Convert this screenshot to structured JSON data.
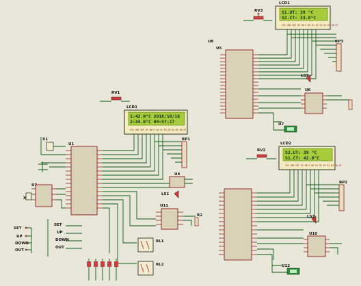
{
  "lcds": [
    {
      "id": "lcd-top",
      "label": "LCD1",
      "line1": "S1.UT: 39 °C",
      "line2": "S2.CT: 34.0°C"
    },
    {
      "id": "lcd-left",
      "label": "LCD1",
      "line1": "1:42.0°C  2018/10/16",
      "line2": "2:34.0°C    09:57:17"
    },
    {
      "id": "lcd-right",
      "label": "LCD2",
      "line1": "S2.UT: 39 °C",
      "line2": "S1.CT: 42.0°C"
    }
  ],
  "components": {
    "u1": "U1",
    "u2": "U2",
    "u4": "U4",
    "u5": "U5",
    "u6": "U6",
    "u7": "U7",
    "u8": "U8",
    "u10": "U10",
    "u11": "U11",
    "u12": "U12",
    "rv1": "RV1",
    "rv2": "RV2",
    "rv3": "RV3",
    "rp1": "RP1",
    "rp2": "RP2",
    "rp3": "RP3",
    "ls1": "LS1",
    "ls2": "LS2",
    "ls3": "LS3",
    "rl1": "RL1",
    "rl2": "RL2",
    "r2": "R2",
    "x1": "X1",
    "x2": "X2"
  },
  "buttons": [
    "SET",
    "UP",
    "DOWN",
    "OUT"
  ],
  "buttons2": [
    "SET",
    "UP",
    "DOWN",
    "OUT"
  ]
}
